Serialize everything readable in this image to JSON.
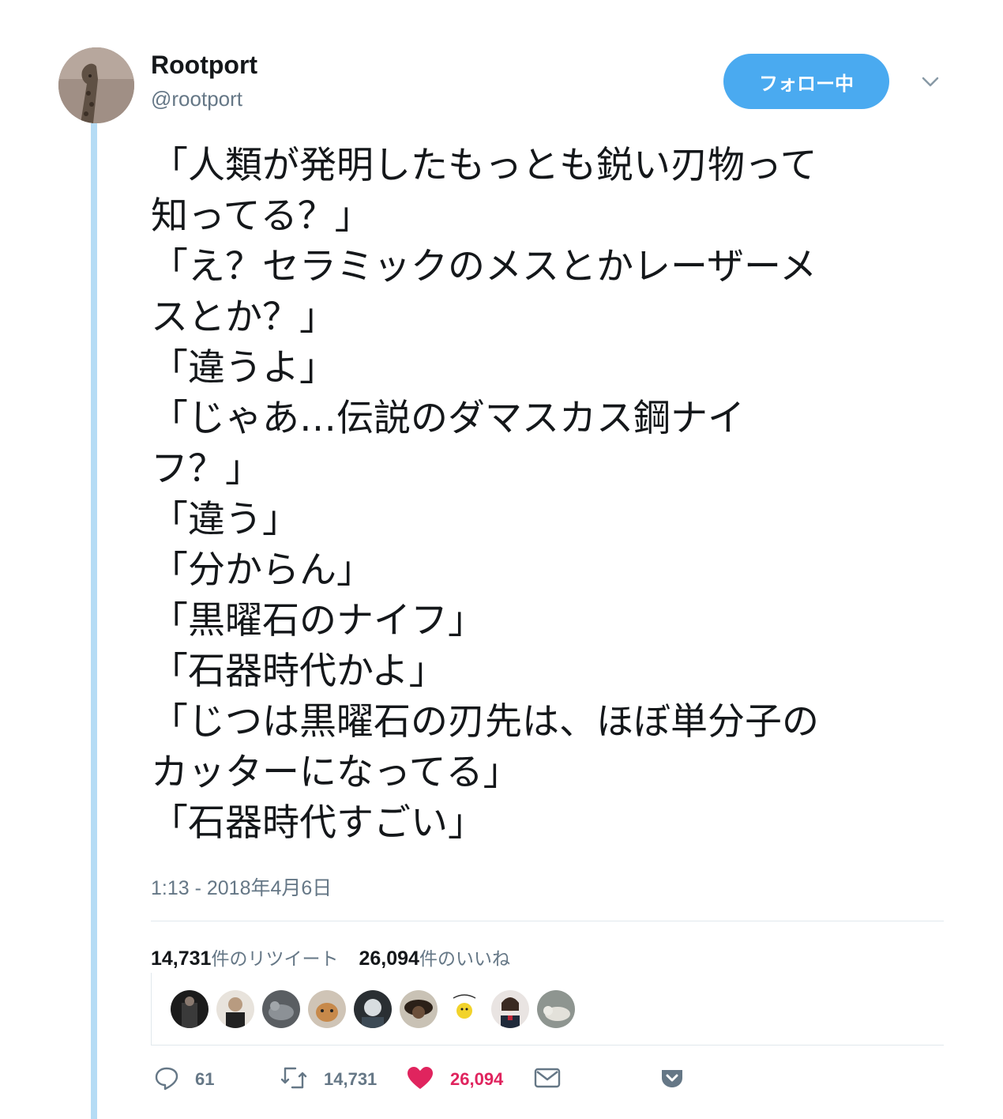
{
  "author": {
    "name": "Rootport",
    "handle": "@rootport"
  },
  "follow_button": {
    "label": "フォロー中"
  },
  "menu_icon": "chevron-down-icon",
  "tweet": {
    "lines": [
      "「人類が発明したもっとも鋭い刃物って",
      "知ってる？」",
      "「え？セラミックのメスとかレーザーメ",
      "スとか？」",
      "「違うよ」",
      "「じゃあ…伝説のダマスカス鋼ナイ",
      "フ？」",
      "「違う」",
      "「分からん」",
      "「黒曜石のナイフ」",
      "「石器時代かよ」",
      "「じつは黒曜石の刃先は、ほぼ単分子の",
      "カッターになってる」",
      "「石器時代すごい」"
    ],
    "timestamp": "1:13 - 2018年4月6日"
  },
  "stats": {
    "retweets_num": "14,731",
    "retweets_label": "件のリツイート",
    "likes_num": "26,094",
    "likes_label": "件のいいね"
  },
  "actions": {
    "reply_count": "61",
    "retweet_count": "14,731",
    "like_count": "26,094"
  },
  "colors": {
    "accent": "#4aaaf0",
    "like": "#e0245e",
    "muted": "#657786",
    "thread_line": "#b5dcf5"
  },
  "liker_avatars": [
    "avatar-1",
    "avatar-2",
    "avatar-3",
    "avatar-4",
    "avatar-5",
    "avatar-6",
    "avatar-7",
    "avatar-8",
    "avatar-9"
  ]
}
